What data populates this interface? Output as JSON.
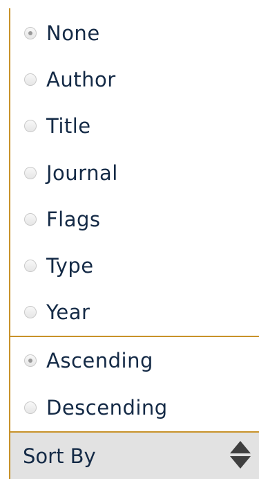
{
  "sort_field": {
    "options": [
      {
        "label": "None",
        "checked": true
      },
      {
        "label": "Author",
        "checked": false
      },
      {
        "label": "Title",
        "checked": false
      },
      {
        "label": "Journal",
        "checked": false
      },
      {
        "label": "Flags",
        "checked": false
      },
      {
        "label": "Type",
        "checked": false
      },
      {
        "label": "Year",
        "checked": false
      }
    ]
  },
  "sort_order": {
    "options": [
      {
        "label": "Ascending",
        "checked": true
      },
      {
        "label": "Descending",
        "checked": false
      }
    ]
  },
  "sort_bar": {
    "label": "Sort By",
    "icon": "up-down-stepper-icon"
  },
  "colors": {
    "accent_border": "#c8922a",
    "text": "#142a46",
    "bar_background": "#e2e2e2"
  }
}
